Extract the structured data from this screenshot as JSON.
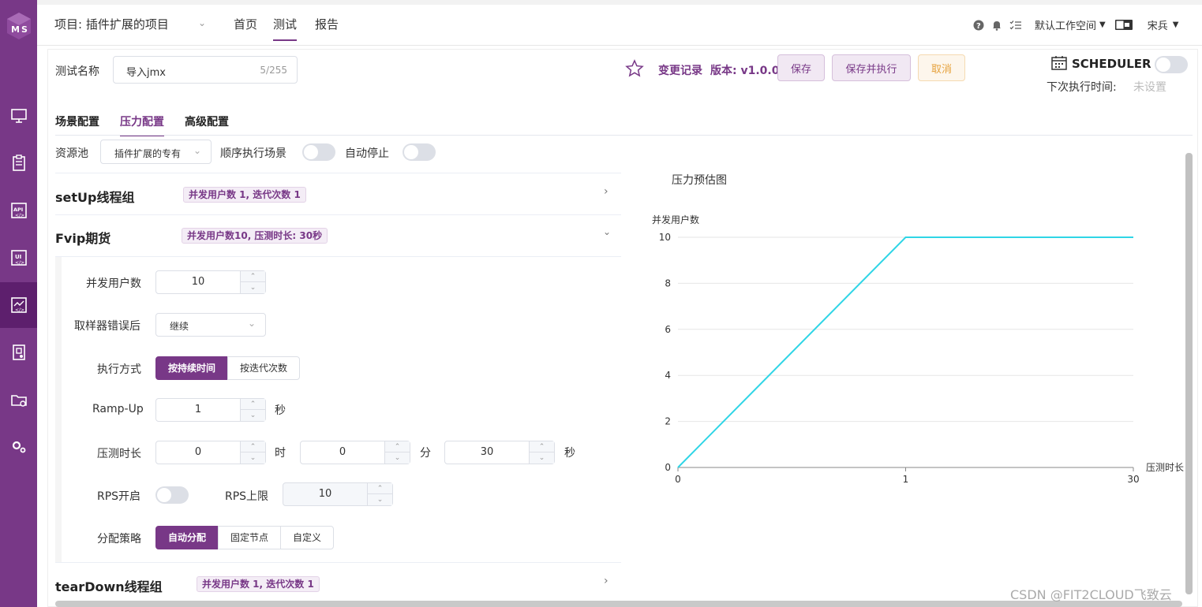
{
  "sidebar": {
    "logo": "MS"
  },
  "header": {
    "project": "项目: 插件扩展的项目",
    "nav": [
      "首页",
      "测试",
      "报告"
    ],
    "workspace": "默认工作空间",
    "user": "宋兵"
  },
  "form": {
    "name_label": "测试名称",
    "name_value": "导入jmx",
    "name_count": "5/255",
    "change_log": "变更记录",
    "version": "版本: v1.0.0",
    "save": "保存",
    "save_run": "保存并执行",
    "cancel": "取消",
    "scheduler": "SCHEDULER",
    "next_run_label": "下次执行时间:",
    "next_run_value": "未设置"
  },
  "tabs": [
    "场景配置",
    "压力配置",
    "高级配置"
  ],
  "config": {
    "pool_label": "资源池",
    "pool_value": "插件扩展的专有",
    "serial_label": "顺序执行场景",
    "auto_stop_label": "自动停止"
  },
  "groups": [
    {
      "name": "setUp线程组",
      "tag": "并发用户数 1, 迭代次数 1"
    },
    {
      "name": "Fvip期货",
      "tag": "并发用户数10, 压测时长: 30秒"
    },
    {
      "name": "tearDown线程组",
      "tag": "并发用户数 1, 迭代次数 1"
    }
  ],
  "detail": {
    "users_label": "并发用户数",
    "users_value": "10",
    "on_error_label": "取样器错误后",
    "on_error_value": "继续",
    "mode_label": "执行方式",
    "mode_options": [
      "按持续时间",
      "按迭代次数"
    ],
    "rampup_label": "Ramp-Up",
    "rampup_value": "1",
    "unit_sec": "秒",
    "duration_label": "压测时长",
    "hours": "0",
    "unit_hour": "时",
    "minutes": "0",
    "unit_min": "分",
    "seconds": "30",
    "rps_label": "RPS开启",
    "rps_limit_label": "RPS上限",
    "rps_limit_value": "10",
    "strategy_label": "分配策略",
    "strategy_options": [
      "自动分配",
      "固定节点",
      "自定义"
    ]
  },
  "chart_data": {
    "type": "line",
    "title": "压力预估图",
    "ylabel": "并发用户数",
    "xlabel": "压测时长",
    "x_ticks": [
      "0",
      "1",
      "30"
    ],
    "y_ticks": [
      0,
      2,
      4,
      6,
      8,
      10
    ],
    "ylim": [
      0,
      10
    ],
    "series": [
      {
        "points": [
          [
            "0",
            0
          ],
          [
            "1",
            10
          ],
          [
            "30",
            10
          ]
        ]
      }
    ],
    "line_color": "#2fd5e6",
    "grid": true
  },
  "watermark": "CSDN @FIT2CLOUD飞致云"
}
